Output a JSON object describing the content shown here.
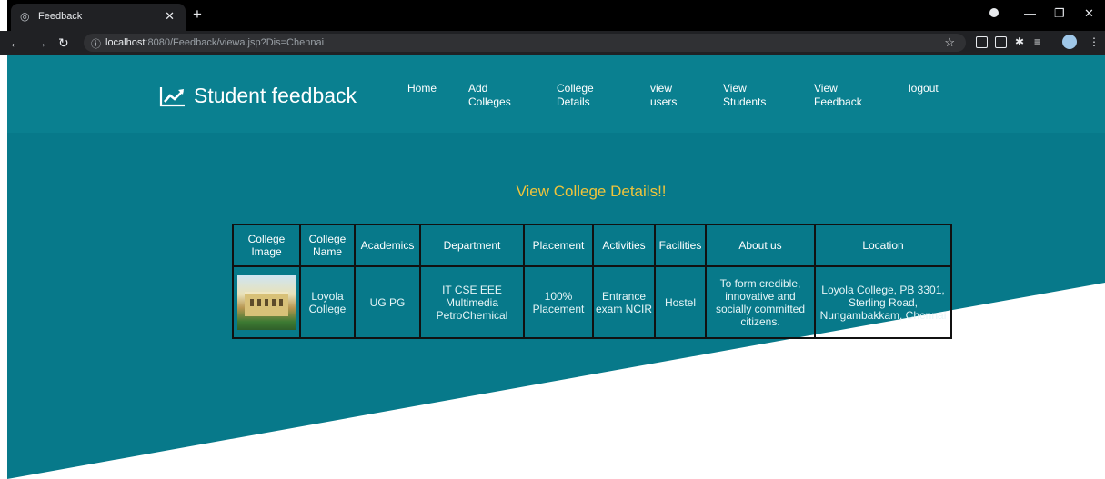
{
  "browser": {
    "tab_title": "Feedback",
    "url_host": "localhost",
    "url_rest": ":8080/Feedback/viewa.jsp?Dis=Chennai"
  },
  "header": {
    "brand": "Student feedback",
    "nav": [
      {
        "line1": "Home",
        "line2": ""
      },
      {
        "line1": "Add",
        "line2": "Colleges"
      },
      {
        "line1": "College",
        "line2": "Details"
      },
      {
        "line1": "view",
        "line2": "users"
      },
      {
        "line1": "View",
        "line2": "Students"
      },
      {
        "line1": "View",
        "line2": "Feedback"
      },
      {
        "line1": "logout",
        "line2": ""
      }
    ]
  },
  "main": {
    "heading": "View College Details!!",
    "table": {
      "headers": [
        [
          "College",
          "Image"
        ],
        [
          "College",
          "Name"
        ],
        [
          "Academics"
        ],
        [
          "Department"
        ],
        [
          "Placement"
        ],
        [
          "Activities"
        ],
        [
          "Facilities"
        ],
        [
          "About us"
        ],
        [
          "Location"
        ]
      ],
      "row": {
        "name": [
          "Loyola",
          "College"
        ],
        "academics": [
          "UG PG"
        ],
        "department": [
          "IT CSE EEE",
          "Multimedia",
          "PetroChemical"
        ],
        "placement": [
          "100%",
          "Placement"
        ],
        "activities": [
          "Entrance",
          "exam NCIR"
        ],
        "facilities": [
          "Hostel"
        ],
        "about": [
          "To form credible,",
          "innovative and",
          "socially committed",
          "citizens."
        ],
        "location": [
          "Loyola College, PB 3301,",
          "Sterling Road,",
          "Nungambakkam, Chennai"
        ]
      }
    }
  },
  "colors": {
    "page_bg": "#087d8d",
    "header_bg": "#0a8090",
    "heading": "#f0c43b"
  }
}
